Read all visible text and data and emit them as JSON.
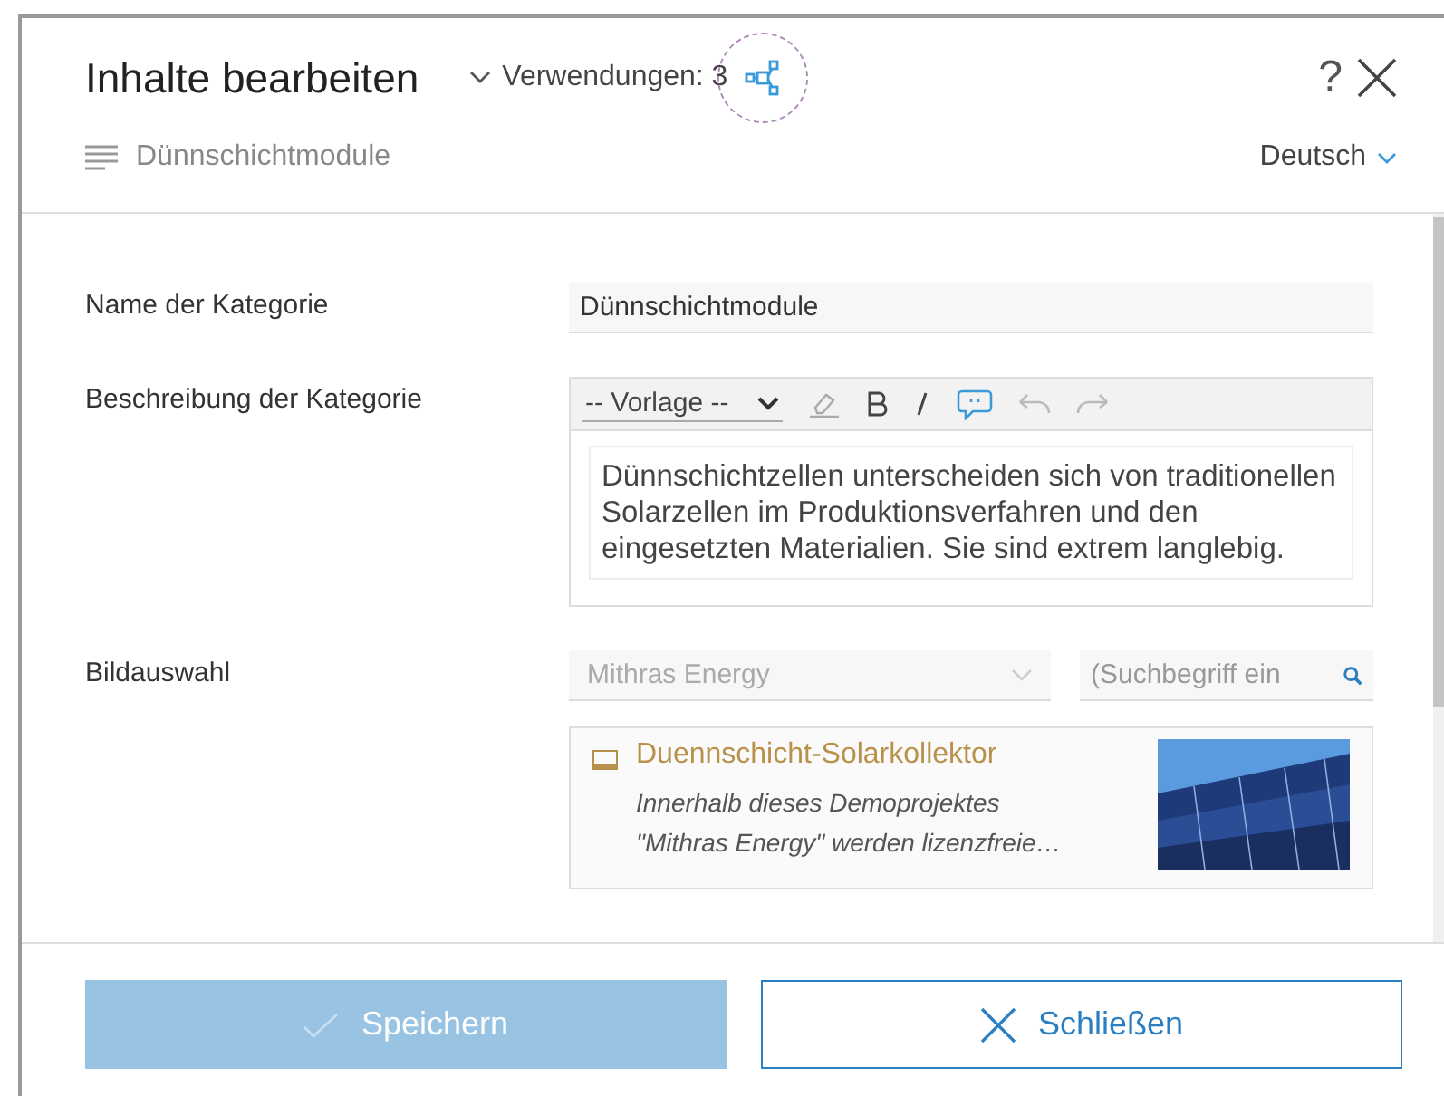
{
  "header": {
    "title": "Inhalte bearbeiten",
    "usages": "Verwendungen: 3",
    "help": "?",
    "breadcrumb": "Dünnschichtmodule",
    "language": "Deutsch"
  },
  "fields": [
    {
      "label": "Name der Kategorie",
      "kind": "text",
      "value": "Dünnschichtmodule"
    },
    {
      "label": "Beschreibung der Kategorie",
      "kind": "editor",
      "template": "-- Vorlage --",
      "value": "Dünnschichtzellen unterscheiden sich von traditionellen Solarzellen im Produktionsverfahren und den eingesetzten Materialien. Sie sind extrem langlebig."
    },
    {
      "label": "Bildauswahl",
      "kind": "images",
      "source": "Mithras Energy",
      "placeholder": "(Suchbegriff ein",
      "items": [
        {
          "title": "Duennschicht-Solarkollektor",
          "description": "Innerhalb dieses Demoprojektes \"Mithras Energy\" werden lizenzfreie…",
          "checked": false
        }
      ]
    }
  ],
  "buttons": [
    {
      "kind": "save",
      "label": "Speichern",
      "disabled": true
    },
    {
      "kind": "close",
      "label": "Schließen",
      "disabled": false
    }
  ]
}
